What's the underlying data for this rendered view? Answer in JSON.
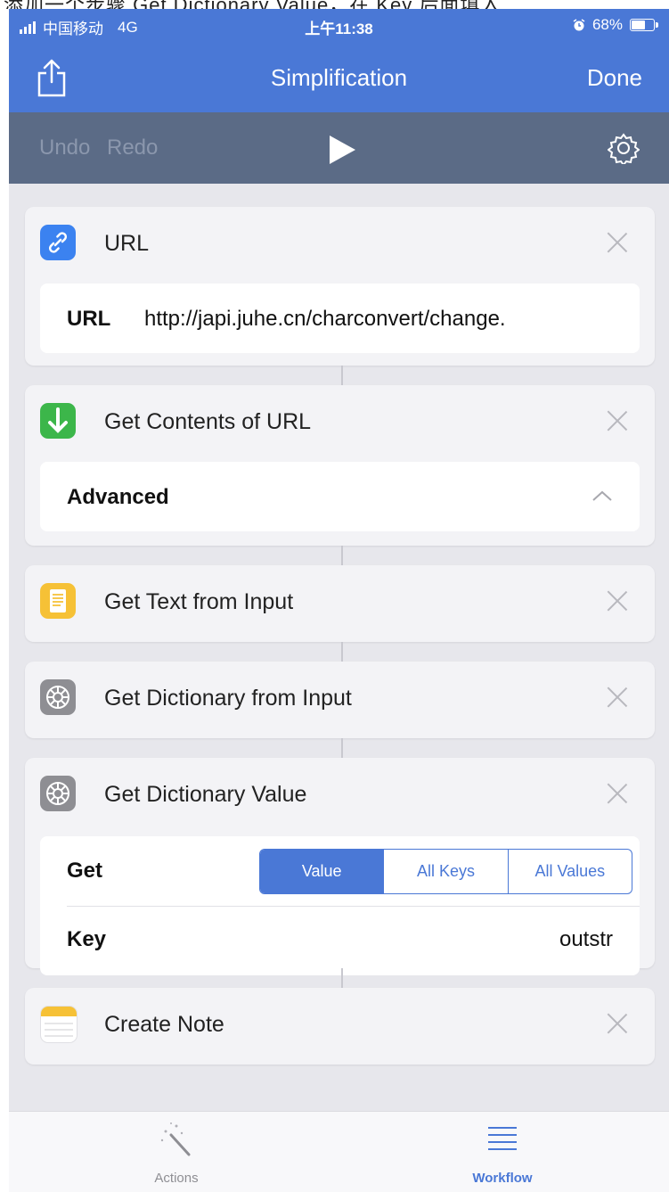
{
  "top_strip": {
    "text": "添加一个步骤 Get Dictionary Value，在 Key 后面填入"
  },
  "status_bar": {
    "carrier": "中国移动",
    "network": "4G",
    "time": "上午11:38",
    "battery_percent": "68%",
    "battery_level": 0.68,
    "alarm_icon": "alarm-clock-icon"
  },
  "nav": {
    "title": "Simplification",
    "done_label": "Done",
    "share_icon": "share-icon"
  },
  "toolbar": {
    "undo_label": "Undo",
    "redo_label": "Redo",
    "play_icon": "play-icon",
    "settings_icon": "gear-icon"
  },
  "actions": [
    {
      "title": "URL",
      "icon": "link-icon",
      "icon_color": "#3b82f0",
      "field_label": "URL",
      "field_value": "http://japi.juhe.cn/charconvert/change."
    },
    {
      "title": "Get Contents of URL",
      "icon": "download-arrow-icon",
      "icon_color": "#3cb64a",
      "row_label": "Advanced",
      "row_icon": "chevron-up-icon"
    },
    {
      "title": "Get Text from Input",
      "icon": "text-document-icon",
      "icon_color": "#f6c136"
    },
    {
      "title": "Get Dictionary from Input",
      "icon": "gear-icon",
      "icon_color": "#8e8e93"
    },
    {
      "title": "Get Dictionary Value",
      "icon": "gear-icon",
      "icon_color": "#8e8e93",
      "get_label": "Get",
      "segments": [
        "Value",
        "All Keys",
        "All Values"
      ],
      "selected_segment": "Value",
      "key_label": "Key",
      "key_value": "outstr"
    },
    {
      "title": "Create Note",
      "icon": "notes-icon",
      "icon_color": "#f6c136"
    }
  ],
  "tabs": [
    {
      "label": "Actions",
      "icon": "magic-wand-icon",
      "active": false
    },
    {
      "label": "Workflow",
      "icon": "list-icon",
      "active": true
    }
  ],
  "colors": {
    "accent": "#4a78d6",
    "toolbar": "#5b6b86",
    "background": "#e7e7ec"
  }
}
